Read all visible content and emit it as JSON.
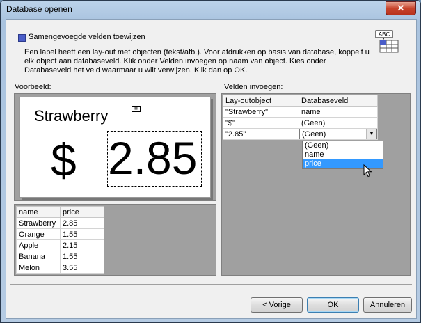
{
  "window": {
    "title": "Database openen",
    "close_glyph": "✕"
  },
  "heading": "Samengevoegde velden toewijzen",
  "description": "Een label heeft een lay-out met objecten (tekst/afb.). Voor afdrukken op basis van database, koppelt u elk object aan databaseveld. Klik onder Velden invoegen op naam van object. Kies onder Databaseveld het veld waarmaar u wilt verwijzen. Klik dan op OK.",
  "preview": {
    "label": "Voorbeeld:",
    "name_text": "Strawberry",
    "dollar_text": "$",
    "price_text": "2.85"
  },
  "data_table": {
    "columns": [
      "name",
      "price"
    ],
    "rows": [
      [
        "Strawberry",
        "2.85"
      ],
      [
        "Orange",
        "1.55"
      ],
      [
        "Apple",
        "2.15"
      ],
      [
        "Banana",
        "1.55"
      ],
      [
        "Melon",
        "3.55"
      ]
    ]
  },
  "fields": {
    "label": "Velden invoegen:",
    "columns": [
      "Lay-outobject",
      "Databaseveld"
    ],
    "rows": [
      [
        "\"Strawberry\"",
        "name"
      ],
      [
        "\"$\"",
        "(Geen)"
      ],
      [
        "\"2.85\"",
        "(Geen)"
      ]
    ],
    "dropdown_options": [
      "(Geen)",
      "name",
      "price"
    ],
    "highlighted_option": "price"
  },
  "buttons": {
    "back": "< Vorige",
    "ok": "OK",
    "cancel": "Annuleren"
  },
  "colors": {
    "heading_icon": "#4a5dc8",
    "selection": "#3399ff",
    "close": "#c7442c"
  }
}
